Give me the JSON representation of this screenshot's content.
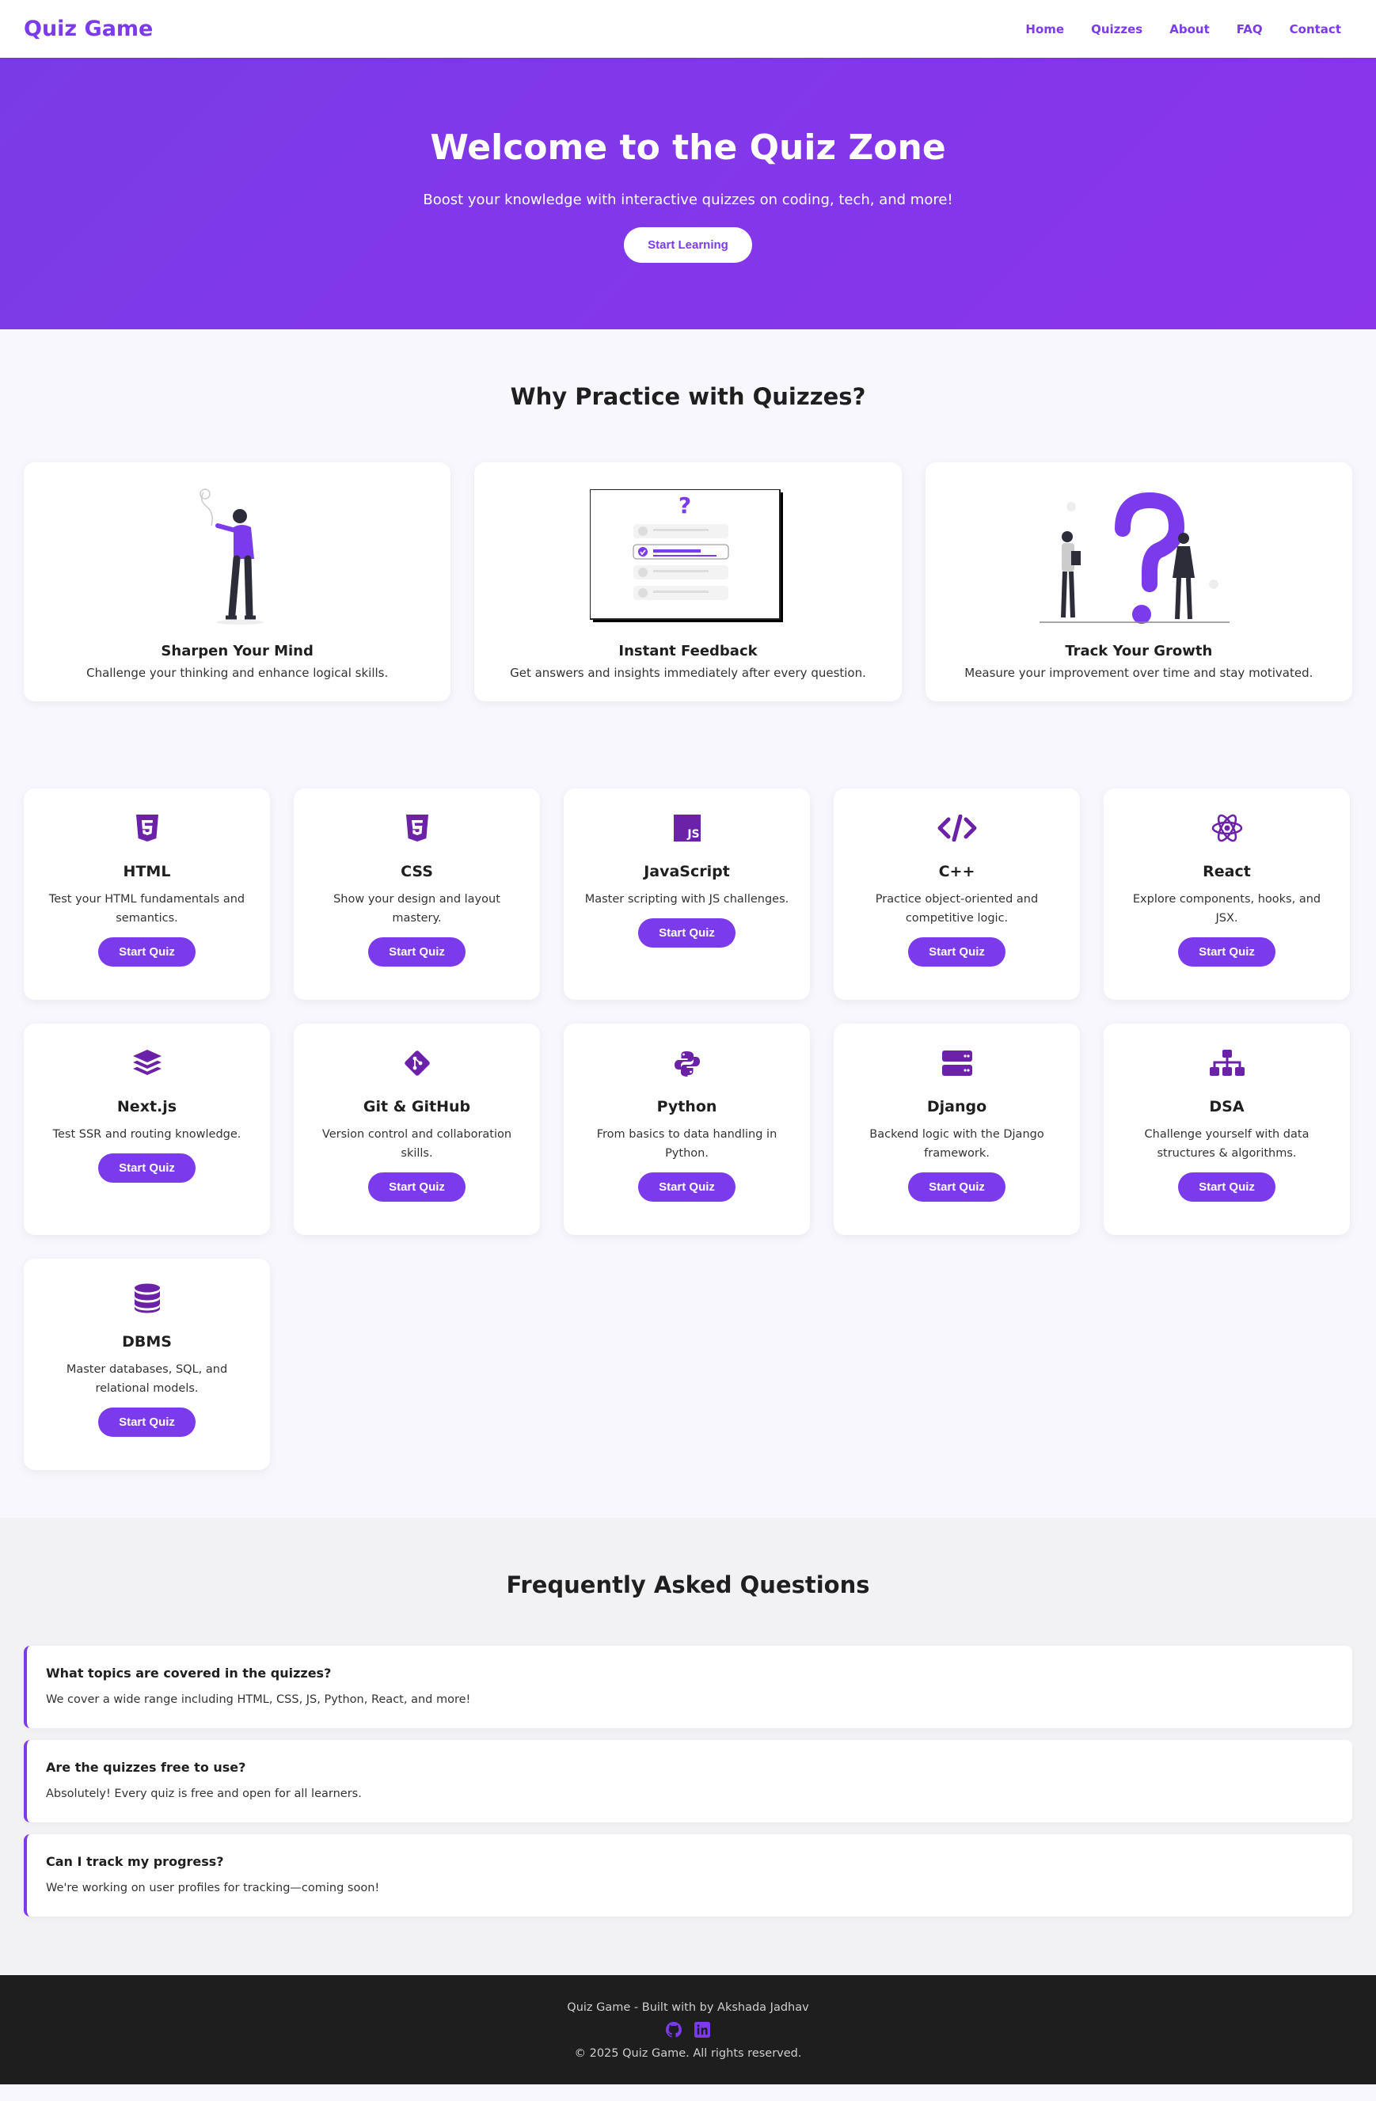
{
  "nav": {
    "brand": "Quiz Game",
    "links": [
      "Home",
      "Quizzes",
      "About",
      "FAQ",
      "Contact"
    ]
  },
  "hero": {
    "title": "Welcome to the Quiz Zone",
    "subtitle": "Boost your knowledge with interactive quizzes on coding, tech, and more!",
    "button": "Start Learning"
  },
  "why": {
    "title": "Why Practice with Quizzes?",
    "cards": [
      {
        "title": "Sharpen Your Mind",
        "text": "Challenge your thinking and enhance logical skills."
      },
      {
        "title": "Instant Feedback",
        "text": "Get answers and insights immediately after every question."
      },
      {
        "title": "Track Your Growth",
        "text": "Measure your improvement over time and stay motivated."
      }
    ]
  },
  "quizzes": [
    {
      "icon": "html5-icon",
      "title": "HTML",
      "text": "Test your HTML fundamentals and semantics.",
      "button": "Start Quiz"
    },
    {
      "icon": "css3-icon",
      "title": "CSS",
      "text": "Show your design and layout mastery.",
      "button": "Start Quiz"
    },
    {
      "icon": "js-icon",
      "title": "JavaScript",
      "text": "Master scripting with JS challenges.",
      "button": "Start Quiz"
    },
    {
      "icon": "code-icon",
      "title": "C++",
      "text": "Practice object-oriented and competitive logic.",
      "button": "Start Quiz"
    },
    {
      "icon": "react-icon",
      "title": "React",
      "text": "Explore components, hooks, and JSX.",
      "button": "Start Quiz"
    },
    {
      "icon": "layers-icon",
      "title": "Next.js",
      "text": "Test SSR and routing knowledge.",
      "button": "Start Quiz"
    },
    {
      "icon": "git-icon",
      "title": "Git & GitHub",
      "text": "Version control and collaboration skills.",
      "button": "Start Quiz"
    },
    {
      "icon": "python-icon",
      "title": "Python",
      "text": "From basics to data handling in Python.",
      "button": "Start Quiz"
    },
    {
      "icon": "server-icon",
      "title": "Django",
      "text": "Backend logic with the Django framework.",
      "button": "Start Quiz"
    },
    {
      "icon": "sitemap-icon",
      "title": "DSA",
      "text": "Challenge yourself with data structures & algorithms.",
      "button": "Start Quiz"
    },
    {
      "icon": "database-icon",
      "title": "DBMS",
      "text": "Master databases, SQL, and relational models.",
      "button": "Start Quiz"
    }
  ],
  "faq": {
    "title": "Frequently Asked Questions",
    "items": [
      {
        "q": "What topics are covered in the quizzes?",
        "a": "We cover a wide range including HTML, CSS, JS, Python, React, and more!"
      },
      {
        "q": "Are the quizzes free to use?",
        "a": "Absolutely! Every quiz is free and open for all learners."
      },
      {
        "q": "Can I track my progress?",
        "a": "We're working on user profiles for tracking—coming soon!"
      }
    ]
  },
  "footer": {
    "built": "Quiz Game - Built with by Akshada Jadhav",
    "copyright": "© 2025 Quiz Game. All rights reserved.",
    "social": [
      "github-icon",
      "linkedin-icon"
    ]
  },
  "colors": {
    "accent": "#7c3aed",
    "icon": "#6b21a8",
    "footer": "#1e1e1f"
  }
}
